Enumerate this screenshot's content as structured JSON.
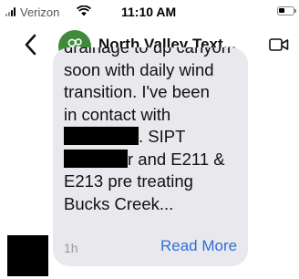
{
  "status_bar": {
    "carrier": "Verizon",
    "time": "11:10 AM"
  },
  "header": {
    "thread_title": "North Valley Text...",
    "icons": {
      "back": "chevron-left-icon",
      "avatar": "group-avatar-icon",
      "video": "video-call-icon"
    },
    "avatar_color": "#3f8a3b"
  },
  "message": {
    "lines": [
      "drainage to up canyon",
      "soon with daily wind",
      "transition.  I've been",
      "in contact with",
      ".  SIPT",
      "r and E211 &",
      "E213 pre treating",
      "Bucks Creek..."
    ],
    "age": "1h",
    "read_more_label": "Read More",
    "link_color": "#2f6fd6",
    "bubble_color": "#e9e9ed"
  }
}
